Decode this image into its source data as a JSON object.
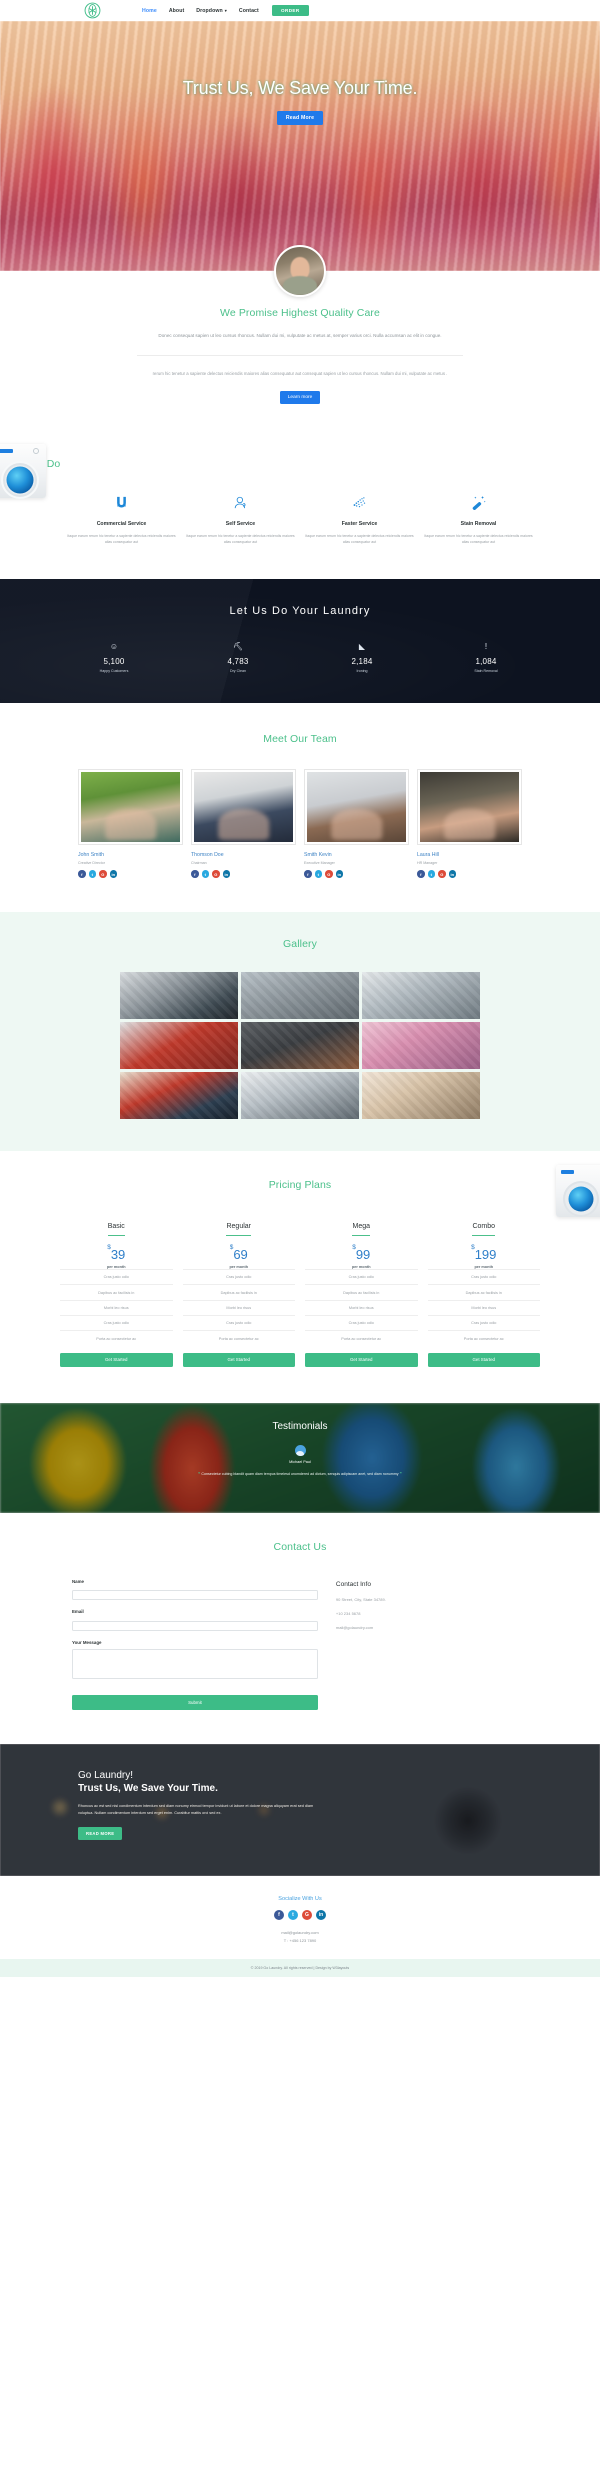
{
  "nav": {
    "logo_icon": "asterisk-badge-icon",
    "links": [
      {
        "label": "Home",
        "active": true
      },
      {
        "label": "About",
        "active": false
      },
      {
        "label": "Dropdown",
        "active": false,
        "caret": "▾"
      },
      {
        "label": "Contact",
        "active": false
      }
    ],
    "order_label": "ORDER"
  },
  "hero": {
    "title": "Trust Us, We Save Your Time.",
    "button": "Read More"
  },
  "promise": {
    "title": "We Promise Highest Quality Care",
    "paragraph": "Donec consequat sapien ut leo cursus rhoncus. Nullam dui mi, vulputate ac metus at, semper varius orci. Nulla accumsan ac elit in congue.",
    "paragraph2": "rerum hic tenetur a sapiente delectus reiciendis maiores alias consequatur aut consequat sapien ut leo cursus rhoncus. Nullam dui mi, vulputate ac metus .",
    "button": "Learn more"
  },
  "whatwedo": {
    "title": "What We Do",
    "services": [
      {
        "icon": "magnet-icon",
        "title": "Commercial Service",
        "desc": "Itaque earum rerum hic tenetur a sapiente delectus reiciendis maiores alias consequatur aut"
      },
      {
        "icon": "person-bust-icon",
        "title": "Self Service",
        "desc": "Itaque earum rerum hic tenetur a sapiente delectus reiciendis maiores alias consequatur aut"
      },
      {
        "icon": "water-spray-icon",
        "title": "Faster Service",
        "desc": "Itaque earum rerum hic tenetur a sapiente delectus reiciendis maiores alias consequatur aut"
      },
      {
        "icon": "magic-wand-icon",
        "title": "Stain Removal",
        "desc": "Itaque earum rerum hic tenetur a sapiente delectus reiciendis maiores alias consequatur aut"
      }
    ]
  },
  "stats": {
    "title": "Let Us Do Your Laundry",
    "items": [
      {
        "icon": "smiley-icon",
        "glyph": "☺",
        "number": "5,100",
        "label": "Happy Customers"
      },
      {
        "icon": "iron-icon",
        "glyph": "⛏",
        "number": "4,783",
        "label": "Dry Clean"
      },
      {
        "icon": "ironing-icon",
        "glyph": "◣",
        "number": "2,184",
        "label": "Ironing"
      },
      {
        "icon": "exclamation-icon",
        "glyph": "!",
        "number": "1,084",
        "label": "Stain Removal"
      }
    ]
  },
  "team": {
    "title": "Meet Our Team",
    "members": [
      {
        "name": "John Smith",
        "role": "Creative Director",
        "photo": "m1"
      },
      {
        "name": "Thomson Doe",
        "role": "Chairman",
        "photo": "m2"
      },
      {
        "name": "Smith Kevin",
        "role": "Executive Manager",
        "photo": "m3"
      },
      {
        "name": "Laura Hill",
        "role": "HR Manager",
        "photo": "m4"
      }
    ],
    "social": [
      {
        "icon": "facebook-icon",
        "glyph": "f",
        "cls": "soc-fb"
      },
      {
        "icon": "twitter-icon",
        "glyph": "t",
        "cls": "soc-tw"
      },
      {
        "icon": "google-plus-icon",
        "glyph": "G",
        "cls": "soc-gp"
      },
      {
        "icon": "linkedin-icon",
        "glyph": "in",
        "cls": "soc-in"
      }
    ]
  },
  "gallery": {
    "title": "Gallery",
    "cells": [
      "g1",
      "g2",
      "g3",
      "g4",
      "g5",
      "g6",
      "g7",
      "g8",
      "g9"
    ]
  },
  "pricing": {
    "title": "Pricing Plans",
    "per_month": "per month",
    "button": "Get Started",
    "features": [
      "Cras justo odio",
      "Dapibus ac facilisis in",
      "Morbi leo risus",
      "Cras justo odio",
      "Porta ac consectetur ac"
    ],
    "plans": [
      {
        "name": "Basic",
        "currency": "$",
        "price": "39"
      },
      {
        "name": "Regular",
        "currency": "$",
        "price": "69"
      },
      {
        "name": "Mega",
        "currency": "$",
        "price": "99"
      },
      {
        "name": "Combo",
        "currency": "$",
        "price": "199"
      }
    ]
  },
  "testimonials": {
    "title": "Testimonials",
    "author": "Michael Paul",
    "quote_open": "❝",
    "quote_close": "❞",
    "text": "Consectetur cubing blandit quam diam tempus timelesd unomdered ad dictum, senquis adipiscam anet, sed diam nonummy"
  },
  "contact": {
    "title": "Contact Us",
    "name_label": "Name",
    "name_value": "",
    "name_placeholder": "",
    "email_label": "Email",
    "email_value": "",
    "email_placeholder": "",
    "message_label": "Your Message",
    "message_value": "",
    "message_placeholder": "",
    "submit": "Submit",
    "info_title": "Contact Info",
    "address": "90 Street, City, State 34789.",
    "phone": "+10 234 5678",
    "email": "mail@golaundry.com"
  },
  "cta": {
    "heading1": "Go Laundry!",
    "heading2": "Trust Us, We Save Your Time.",
    "paragraph": "Rhoncus ac est sed nisl condimentum interdum sed diam nonumy eirmod tempor invidunt ut labore et dolore magna aliquyam erat sed diam voluptua. Nullam condimentum interdum sed erget enim. Curabitur mattis orci sed ex.",
    "button": "READ MORE"
  },
  "footer": {
    "title": "Socialize With Us",
    "social": [
      {
        "icon": "facebook-icon",
        "glyph": "f",
        "cls": "soc-fb"
      },
      {
        "icon": "twitter-icon",
        "glyph": "t",
        "cls": "soc-tw"
      },
      {
        "icon": "google-plus-icon",
        "glyph": "G",
        "cls": "soc-gp"
      },
      {
        "icon": "linkedin-icon",
        "glyph": "in",
        "cls": "soc-in"
      }
    ],
    "email": "mail@golaundry.com",
    "phone": "T : +456 123 7890",
    "copyright": "© 2019 Go Laundry. All rights reserved | Design by W3layouts"
  },
  "colors": {
    "green": "#3dbc87",
    "green_text": "#4cc08b",
    "blue": "#1f7aeb",
    "icon_blue": "#1e88d8",
    "dark": "#0d1320",
    "mint_bg": "#eef8f3"
  }
}
